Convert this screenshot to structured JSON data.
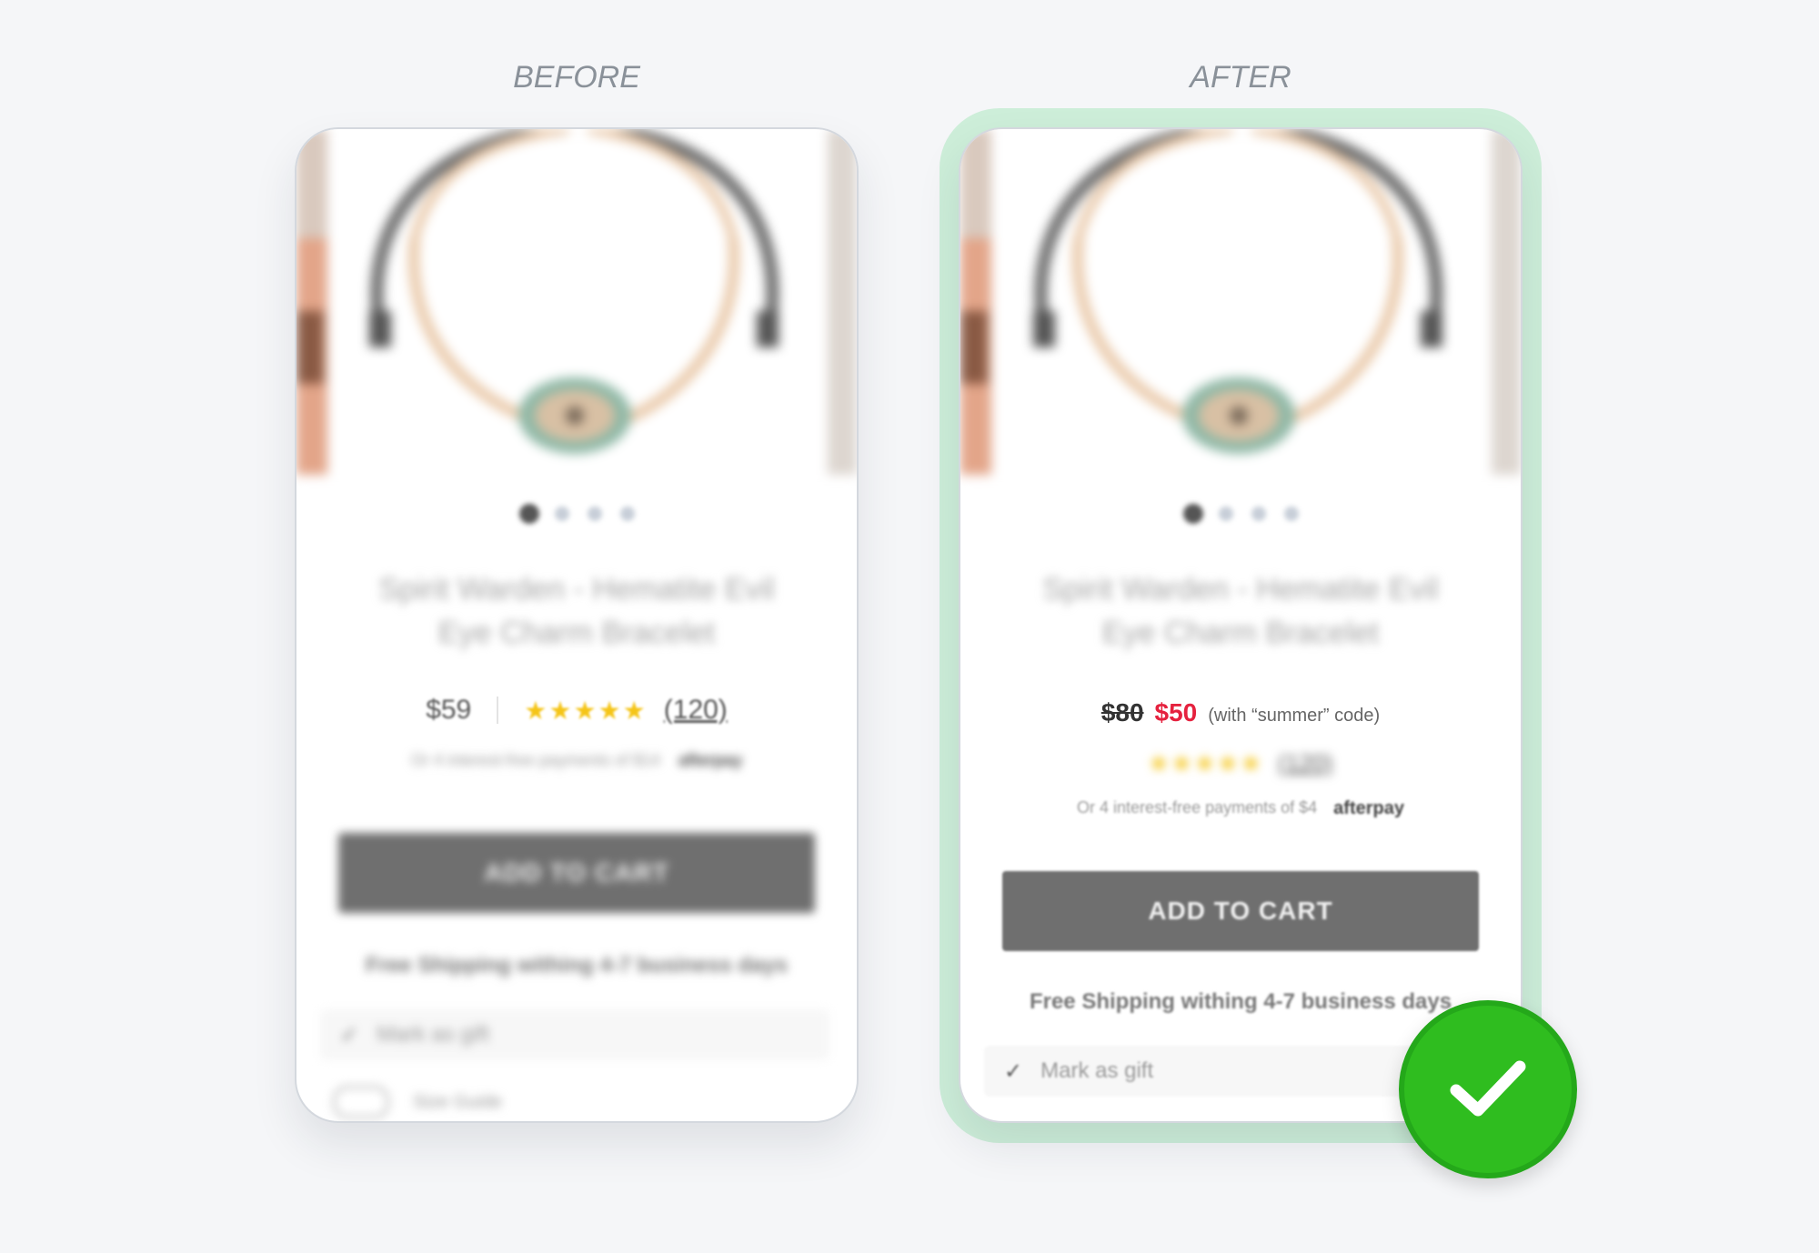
{
  "labels": {
    "before": "BEFORE",
    "after": "AFTER"
  },
  "before": {
    "title": "Spirit Warden - Hematite Evil Eye Charm Bracelet",
    "price": "$59",
    "rating_stars": 5,
    "reviews": "(120)",
    "afterpay_text": "Or 4 interest-free payments of $14",
    "afterpay_brand": "afterpay",
    "cart_label": "ADD TO CART",
    "shipping": "Free Shipping withing 4-7 business days",
    "gift_label": "Mark as gift",
    "extra_label": "Size Guide"
  },
  "after": {
    "title": "Spirit Warden - Hematite Evil Eye Charm Bracelet",
    "old_price": "$80",
    "new_price": "$50",
    "promo_note": "(with “summer” code)",
    "rating_stars": 5,
    "reviews": "(120)",
    "afterpay_text": "Or 4 interest-free payments of $4",
    "afterpay_brand": "afterpay",
    "cart_label": "ADD TO CART",
    "shipping": "Free Shipping withing 4-7 business days",
    "gift_label": "Mark as gift"
  },
  "carousel": {
    "count": 4,
    "active": 0
  },
  "colors": {
    "sale_red": "#e5213e",
    "star_gold": "#f5c518",
    "button_gray": "#6f6f6f",
    "success_green": "#2fbd1f",
    "highlight_green": "#cdeed9"
  }
}
